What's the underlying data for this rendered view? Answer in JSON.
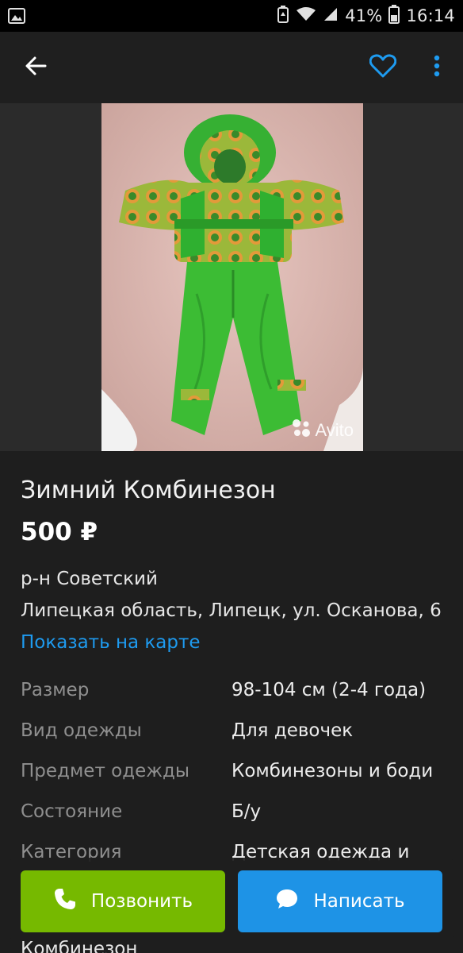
{
  "status_bar": {
    "battery_percent": "41%",
    "time": "16:14"
  },
  "app_bar": {
    "back_icon": "arrow-left-icon",
    "favorite_icon": "heart-outline-icon",
    "more_icon": "more-vertical-icon"
  },
  "photo": {
    "watermark": "Avito"
  },
  "listing": {
    "title": "Зимний Комбинезон",
    "price": "500 ₽",
    "district": "р-н Советский",
    "address": "Липецкая область, Липецк, ул. Осканова, 6",
    "map_link": "Показать на карте"
  },
  "params": [
    {
      "label": "Размер",
      "value": "98-104 см (2-4 года)"
    },
    {
      "label": "Вид одежды",
      "value": "Для девочек"
    },
    {
      "label": "Предмет одежды",
      "value": "Комбинезоны и боди"
    },
    {
      "label": "Состояние",
      "value": "Б/у"
    },
    {
      "label": "Категория",
      "value": "Детская одежда и"
    }
  ],
  "peek_text": "Комбинезон",
  "actions": {
    "call_label": "Позвонить",
    "write_label": "Написать"
  },
  "colors": {
    "accent_blue": "#1e9bf0",
    "call_green": "#76b900",
    "write_blue": "#1e93e6"
  }
}
